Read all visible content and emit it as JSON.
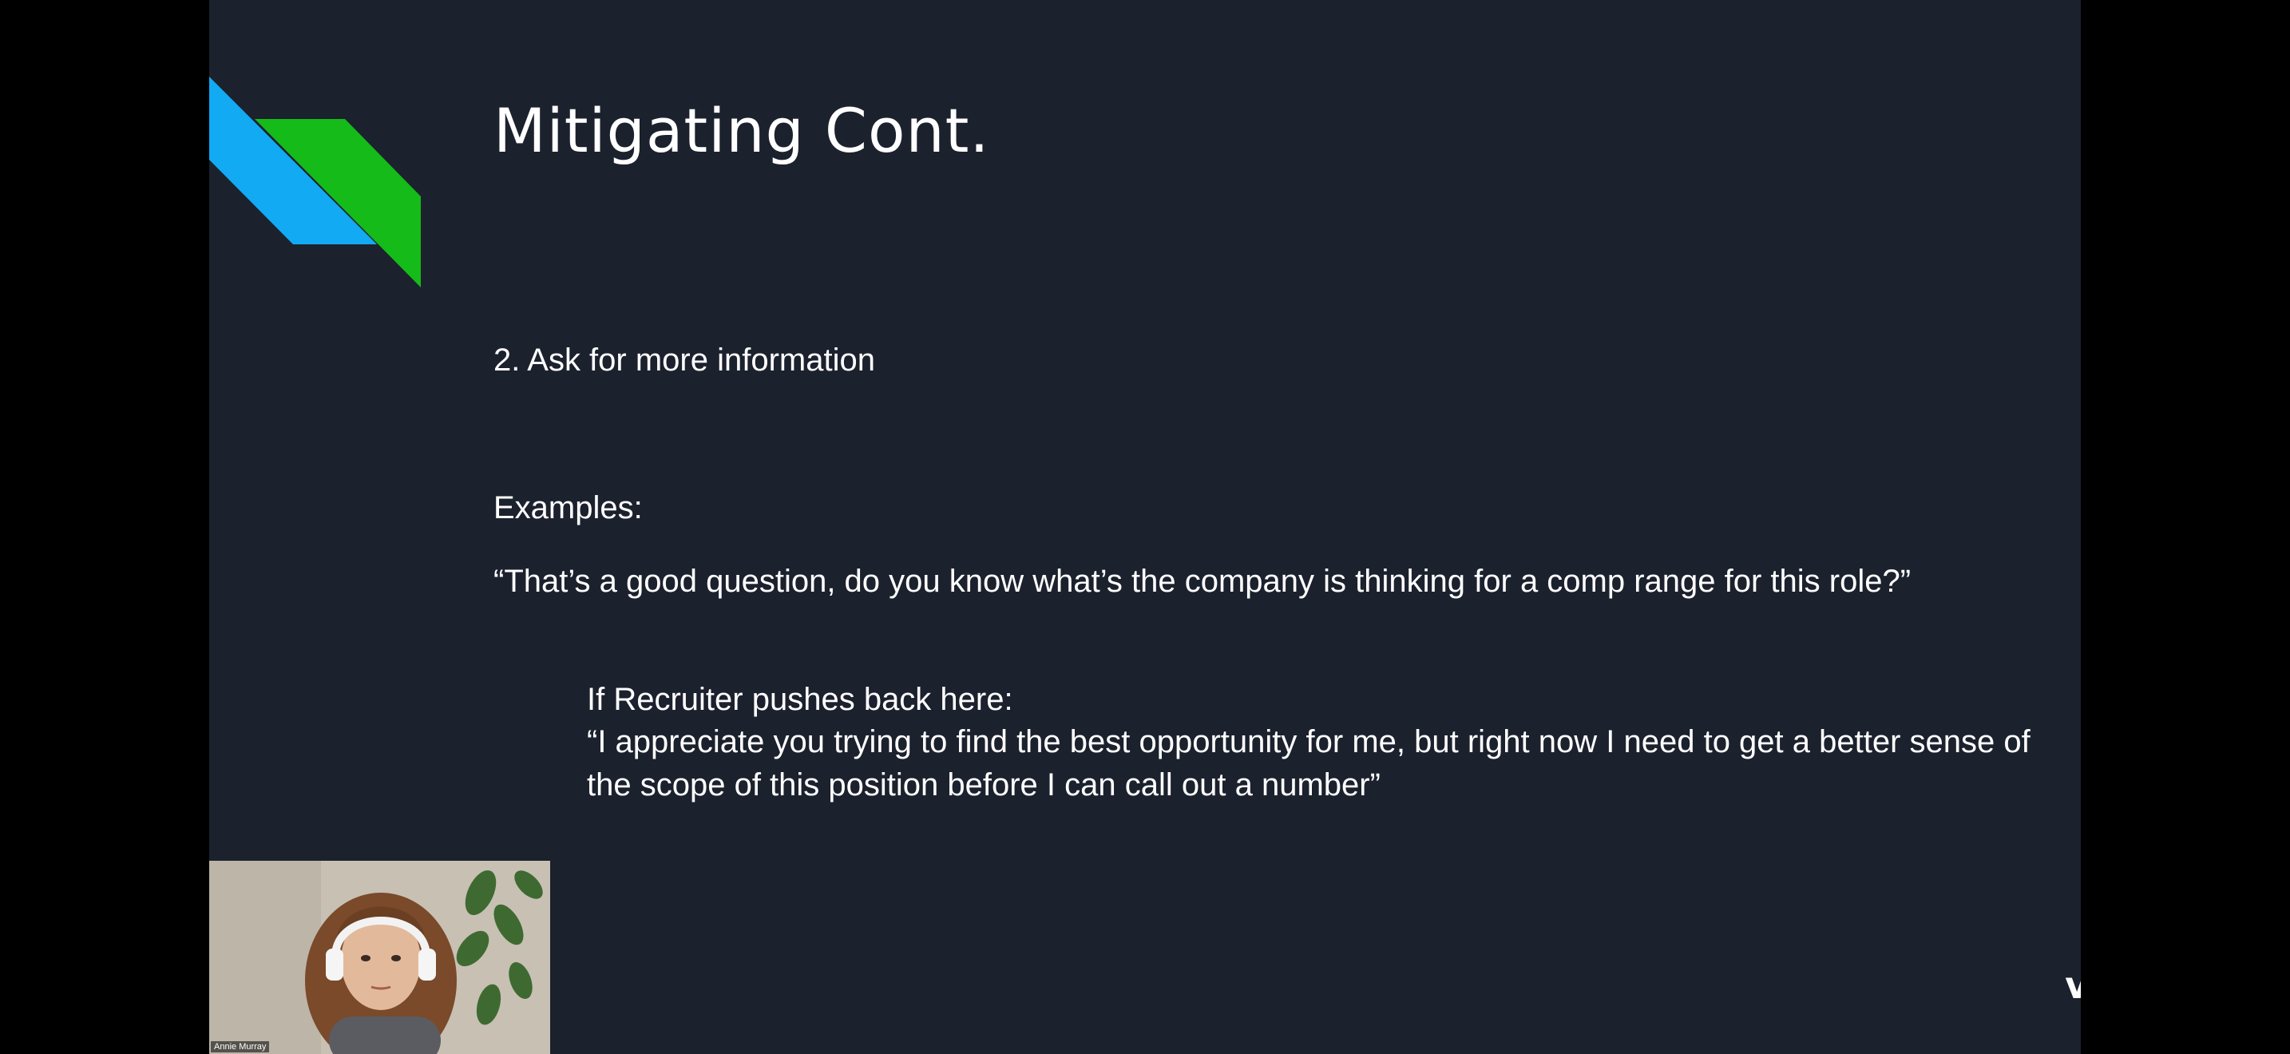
{
  "slide": {
    "title": "Mitigating Cont.",
    "point": "2. Ask for more information",
    "examples_label": "Examples:",
    "quote_1": "“That’s a good question, do you know what’s the company is thinking for a comp range  for this role?”",
    "pushback_label": "If Recruiter pushes back here:",
    "quote_2": "“I appreciate you trying to find the best opportunity for me, but right now I need to get a better sense of the scope of this position before I can call out a number”"
  },
  "webcam": {
    "participant_name": "Annie Murray"
  },
  "logo": {
    "wordmark": "valued",
    "icon": "heart-handshake-icon"
  },
  "colors": {
    "slide_background": "#1c212e",
    "deco_blue": "#12aaf2",
    "deco_green": "#15bb18",
    "logo_teal": "#1ec9b0"
  }
}
